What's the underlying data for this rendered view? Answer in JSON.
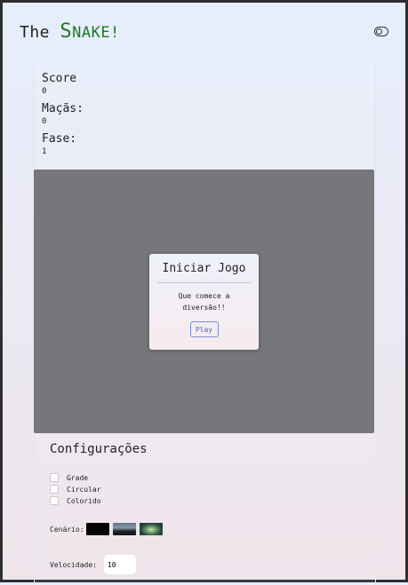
{
  "header": {
    "title_prefix": "The ",
    "title_s": "S",
    "title_rest": "NAKE!"
  },
  "stats": {
    "score_label": "Score",
    "score_value": "0",
    "apples_label": "Maçãs:",
    "apples_value": "0",
    "level_label": "Fase:",
    "level_value": "1"
  },
  "modal": {
    "title": "Iniciar Jogo",
    "text_line1": "Que comece a",
    "text_line2": "diversão!!",
    "play_label": "Play"
  },
  "config": {
    "title": "Configurações",
    "options": [
      {
        "label": "Grade",
        "checked": false
      },
      {
        "label": "Circular",
        "checked": false
      },
      {
        "label": "Colorido",
        "checked": false
      }
    ],
    "scenario_label": "Cenário:",
    "scenarios": [
      "black",
      "mountain",
      "aurora"
    ],
    "speed_label": "Velocidade:",
    "speed_value": "10"
  },
  "colors": {
    "accent_green": "#1c7a20",
    "board_gray": "#76777b",
    "play_blue": "#4a64c8"
  },
  "icons": {
    "theme_toggle": "toggle-switch-icon"
  }
}
